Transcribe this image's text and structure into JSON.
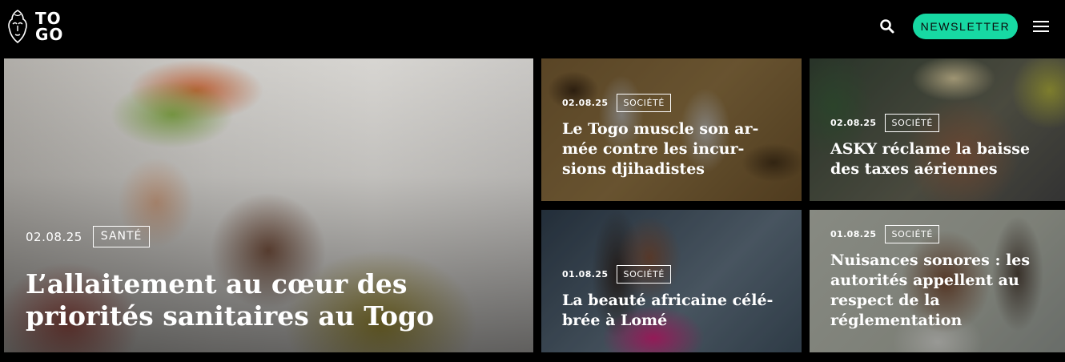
{
  "header": {
    "logo_line1": "TO",
    "logo_line2": "GO",
    "logo_icon": "mask-icon",
    "search_icon": "search-icon",
    "newsletter_label": "NEWSLETTER",
    "menu_icon": "hamburger-menu-icon",
    "accent_color": "#17d9a3"
  },
  "articles": [
    {
      "date": "02.08.25",
      "category": "SANTÉ",
      "title": "L’allaitement au cœur des priorités sanitaires au Togo"
    },
    {
      "date": "02.08.25",
      "category": "SOCIÉTÉ",
      "title": "Le Togo muscle son armée contre les incursions djihadistes",
      "title_lines": [
        "Le Togo muscle son ar-",
        "mée contre les incur-",
        "sions djihadistes"
      ]
    },
    {
      "date": "02.08.25",
      "category": "SOCIÉTÉ",
      "title": "ASKY réclame la baisse des taxes aériennes",
      "title_lines": [
        "ASKY réclame la baisse",
        "des taxes aériennes"
      ]
    },
    {
      "date": "01.08.25",
      "category": "SOCIÉTÉ",
      "title": "La beauté africaine célébrée à Lomé",
      "title_lines": [
        "La beauté africaine célé-",
        "brée à Lomé"
      ]
    },
    {
      "date": "01.08.25",
      "category": "SOCIÉTÉ",
      "title": "Nuisances sonores : les autorités appellent au respect de la réglementation",
      "title_lines": [
        "Nuisances sonores : les",
        "autorités appellent au",
        "respect de la",
        "réglementation"
      ]
    }
  ]
}
